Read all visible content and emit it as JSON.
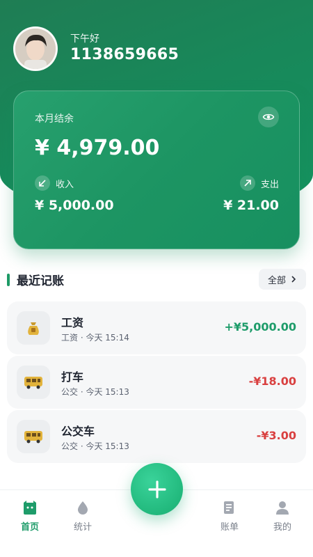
{
  "header": {
    "greeting": "下午好",
    "username": "1138659665"
  },
  "summary": {
    "label": "本月结余",
    "balance": "¥ 4,979.00",
    "income_label": "收入",
    "income_value": "¥ 5,000.00",
    "expense_label": "支出",
    "expense_value": "¥ 21.00"
  },
  "recent": {
    "title": "最近记账",
    "all_label": "全部",
    "items": [
      {
        "title": "工资",
        "subtitle": "工资 · 今天 15:14",
        "amount": "+¥5,000.00",
        "icon": "money-bag-icon"
      },
      {
        "title": "打车",
        "subtitle": "公交 · 今天 15:13",
        "amount": "-¥18.00",
        "icon": "bus-icon"
      },
      {
        "title": "公交车",
        "subtitle": "公交 · 今天 15:13",
        "amount": "-¥3.00",
        "icon": "bus-icon"
      }
    ]
  },
  "tabs": [
    {
      "label": "首页",
      "icon": "home-icon",
      "active": true
    },
    {
      "label": "统计",
      "icon": "stats-icon",
      "active": false
    },
    {
      "label": "账单",
      "icon": "bill-icon",
      "active": false
    },
    {
      "label": "我的",
      "icon": "profile-icon",
      "active": false
    }
  ],
  "colors": {
    "brand": "#1d9a66",
    "income": "#1e9c6a",
    "expense": "#d94040"
  }
}
